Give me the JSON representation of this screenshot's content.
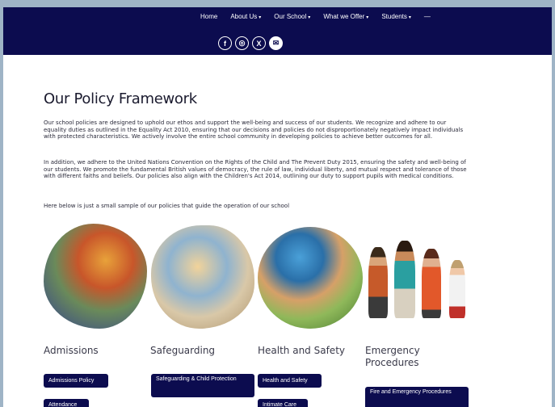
{
  "nav": {
    "items": [
      {
        "label": "Home",
        "has_dropdown": false
      },
      {
        "label": "About Us",
        "has_dropdown": true
      },
      {
        "label": "Our School",
        "has_dropdown": true
      },
      {
        "label": "What we Offer",
        "has_dropdown": true
      },
      {
        "label": "Students",
        "has_dropdown": true
      },
      {
        "label": "—",
        "has_dropdown": false
      }
    ],
    "caret": "▾"
  },
  "social": {
    "facebook_glyph": "f",
    "instagram_glyph": "◎",
    "x_glyph": "X",
    "email_glyph": "✉",
    "icons": [
      "facebook-icon",
      "instagram-icon",
      "x-icon",
      "email-icon"
    ]
  },
  "main": {
    "title": "Our Policy Framework",
    "paragraph1": "Our school policies are designed to uphold our ethos and support the well-being and success of our students. We recognize and adhere to our equality duties as outlined in the Equality Act 2010, ensuring that our decisions and policies do not disproportionately negatively impact individuals with protected characteristics. We actively involve the entire school community in developing policies to achieve better outcomes for all.",
    "paragraph2": "In addition, we adhere to the United Nations Convention on the Rights of the Child and The Prevent Duty 2015, ensuring the safety and well-being of our students. We promote the fundamental British values of democracy, the rule of law, individual liberty, and mutual respect and tolerance of those with different faiths and beliefs. Our policies also align with the Children's Act 2014, outlining our duty to support pupils with medical conditions.",
    "paragraph3": "Here below is just a small sample of our policies that guide the operation of our school"
  },
  "categories": {
    "admissions": "Admissions",
    "safeguarding": "Safeguarding",
    "health": "Health and Safety",
    "emergency": "Emergency Procedures"
  },
  "buttons": {
    "admissions_policy": "Admissions Policy",
    "safeguarding_child": "Safeguarding & Child Protection",
    "health_safety": "Health and Safety",
    "fire_emergency": "Fire and Emergency Procedures",
    "attendance": "Attendance",
    "intimate_care": "Intimate Care"
  },
  "colors": {
    "navy": "#0c0c4f",
    "page_bg": "#9fb4c6"
  }
}
